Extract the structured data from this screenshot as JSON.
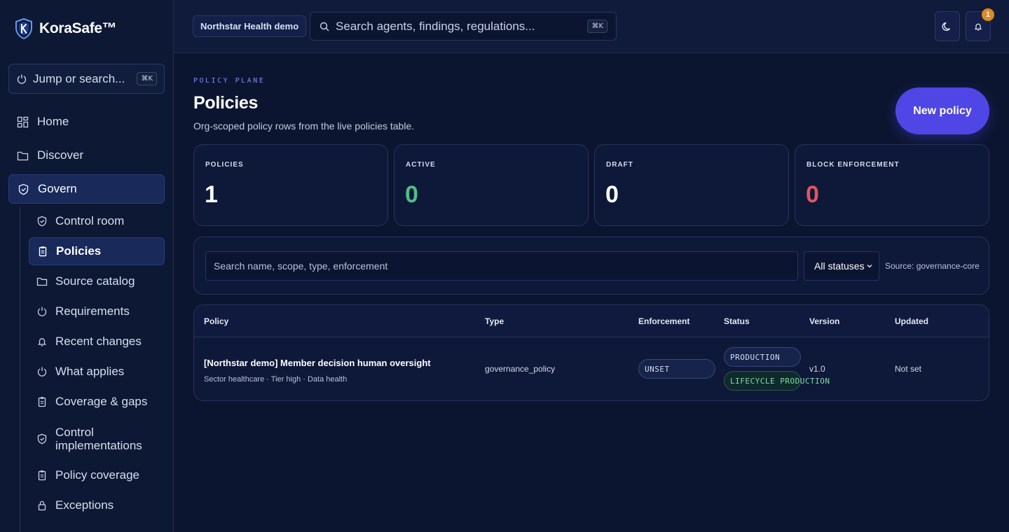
{
  "brand": {
    "name": "KoraSafe™"
  },
  "sidebar": {
    "jump": {
      "label": "Jump or search...",
      "shortcut": "⌘K"
    },
    "items": [
      {
        "label": "Home",
        "icon": "grid-icon"
      },
      {
        "label": "Discover",
        "icon": "folder-icon"
      },
      {
        "label": "Govern",
        "icon": "shield-icon",
        "active": true
      }
    ],
    "subitems": [
      {
        "label": "Control room",
        "icon": "shield-icon"
      },
      {
        "label": "Policies",
        "icon": "clipboard-icon",
        "active": true
      },
      {
        "label": "Source catalog",
        "icon": "folder-icon"
      },
      {
        "label": "Requirements",
        "icon": "power-icon"
      },
      {
        "label": "Recent changes",
        "icon": "bell-icon"
      },
      {
        "label": "What applies",
        "icon": "power-icon"
      },
      {
        "label": "Coverage & gaps",
        "icon": "clipboard-icon"
      },
      {
        "label": "Control implementations",
        "icon": "shield-icon"
      },
      {
        "label": "Policy coverage",
        "icon": "clipboard-icon"
      },
      {
        "label": "Exceptions",
        "icon": "lock-icon"
      }
    ]
  },
  "topbar": {
    "org": "Northstar Health demo",
    "search_placeholder": "Search agents, findings, regulations...",
    "search_shortcut": "⌘K",
    "notifications": "1"
  },
  "page": {
    "eyebrow": "POLICY PLANE",
    "title": "Policies",
    "subtitle": "Org-scoped policy rows from the live policies table.",
    "new_button": "New policy"
  },
  "stats": [
    {
      "label": "POLICIES",
      "value": "1",
      "color": "#ffffff"
    },
    {
      "label": "ACTIVE",
      "value": "0",
      "color": "#4fbf86"
    },
    {
      "label": "DRAFT",
      "value": "0",
      "color": "#ffffff"
    },
    {
      "label": "BLOCK ENFORCEMENT",
      "value": "0",
      "color": "#e0575b"
    }
  ],
  "filters": {
    "search_placeholder": "Search name, scope, type, enforcement",
    "status_select": "All statuses",
    "source": "Source: governance-core"
  },
  "table": {
    "columns": [
      "Policy",
      "Type",
      "Enforcement",
      "Status",
      "Version",
      "Updated"
    ],
    "rows": [
      {
        "name": "[Northstar demo] Member decision human oversight",
        "meta": "Sector healthcare · Tier high · Data health",
        "type": "governance_policy",
        "enforcement": "UNSET",
        "status": "PRODUCTION",
        "lifecycle": "LIFECYCLE PRODUCTION",
        "version": "v1.0",
        "updated": "Not set"
      }
    ]
  },
  "colors": {
    "accent": "#4f46e5",
    "active_green": "#4fbf86",
    "block_red": "#e0575b",
    "badge_orange": "#e08a1e"
  }
}
